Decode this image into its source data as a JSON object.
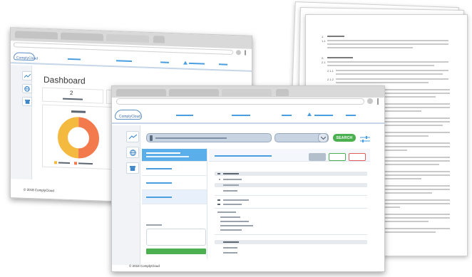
{
  "colors": {
    "accent": "#4a9ee0",
    "active_item": "#5aaeea",
    "search_button": "#4caf50",
    "donut_orange": "#f37a4d",
    "donut_yellow": "#f4b93f",
    "outline_green": "#4caf50",
    "outline_red": "#e25d5d"
  },
  "back_window": {
    "logo_text": "ComplyCloud",
    "page_title": "Dashboard",
    "stat_value": "2",
    "footer": "© 2018 ComplyCloud",
    "donut": [
      {
        "label": "orange",
        "value": 50,
        "color": "#f37a4d"
      },
      {
        "label": "yellow",
        "value": 50,
        "color": "#f4b93f"
      }
    ],
    "sidebar_icons": [
      "chart-line-icon",
      "globe-icon",
      "archive-icon"
    ]
  },
  "front_window": {
    "logo_text": "ComplyCloud",
    "search_button_label": "SEARCH",
    "footer": "© 2018 ComplyCloud",
    "sidebar_icons": [
      "chart-line-icon",
      "globe-icon",
      "archive-icon"
    ],
    "filter_icon": "sliders-icon",
    "select_icon": "chevron-down-icon"
  },
  "document": {
    "section_numbers": [
      "1.",
      "1.1",
      "2.",
      "2.1",
      "2.1.1",
      "2.1.2"
    ]
  }
}
